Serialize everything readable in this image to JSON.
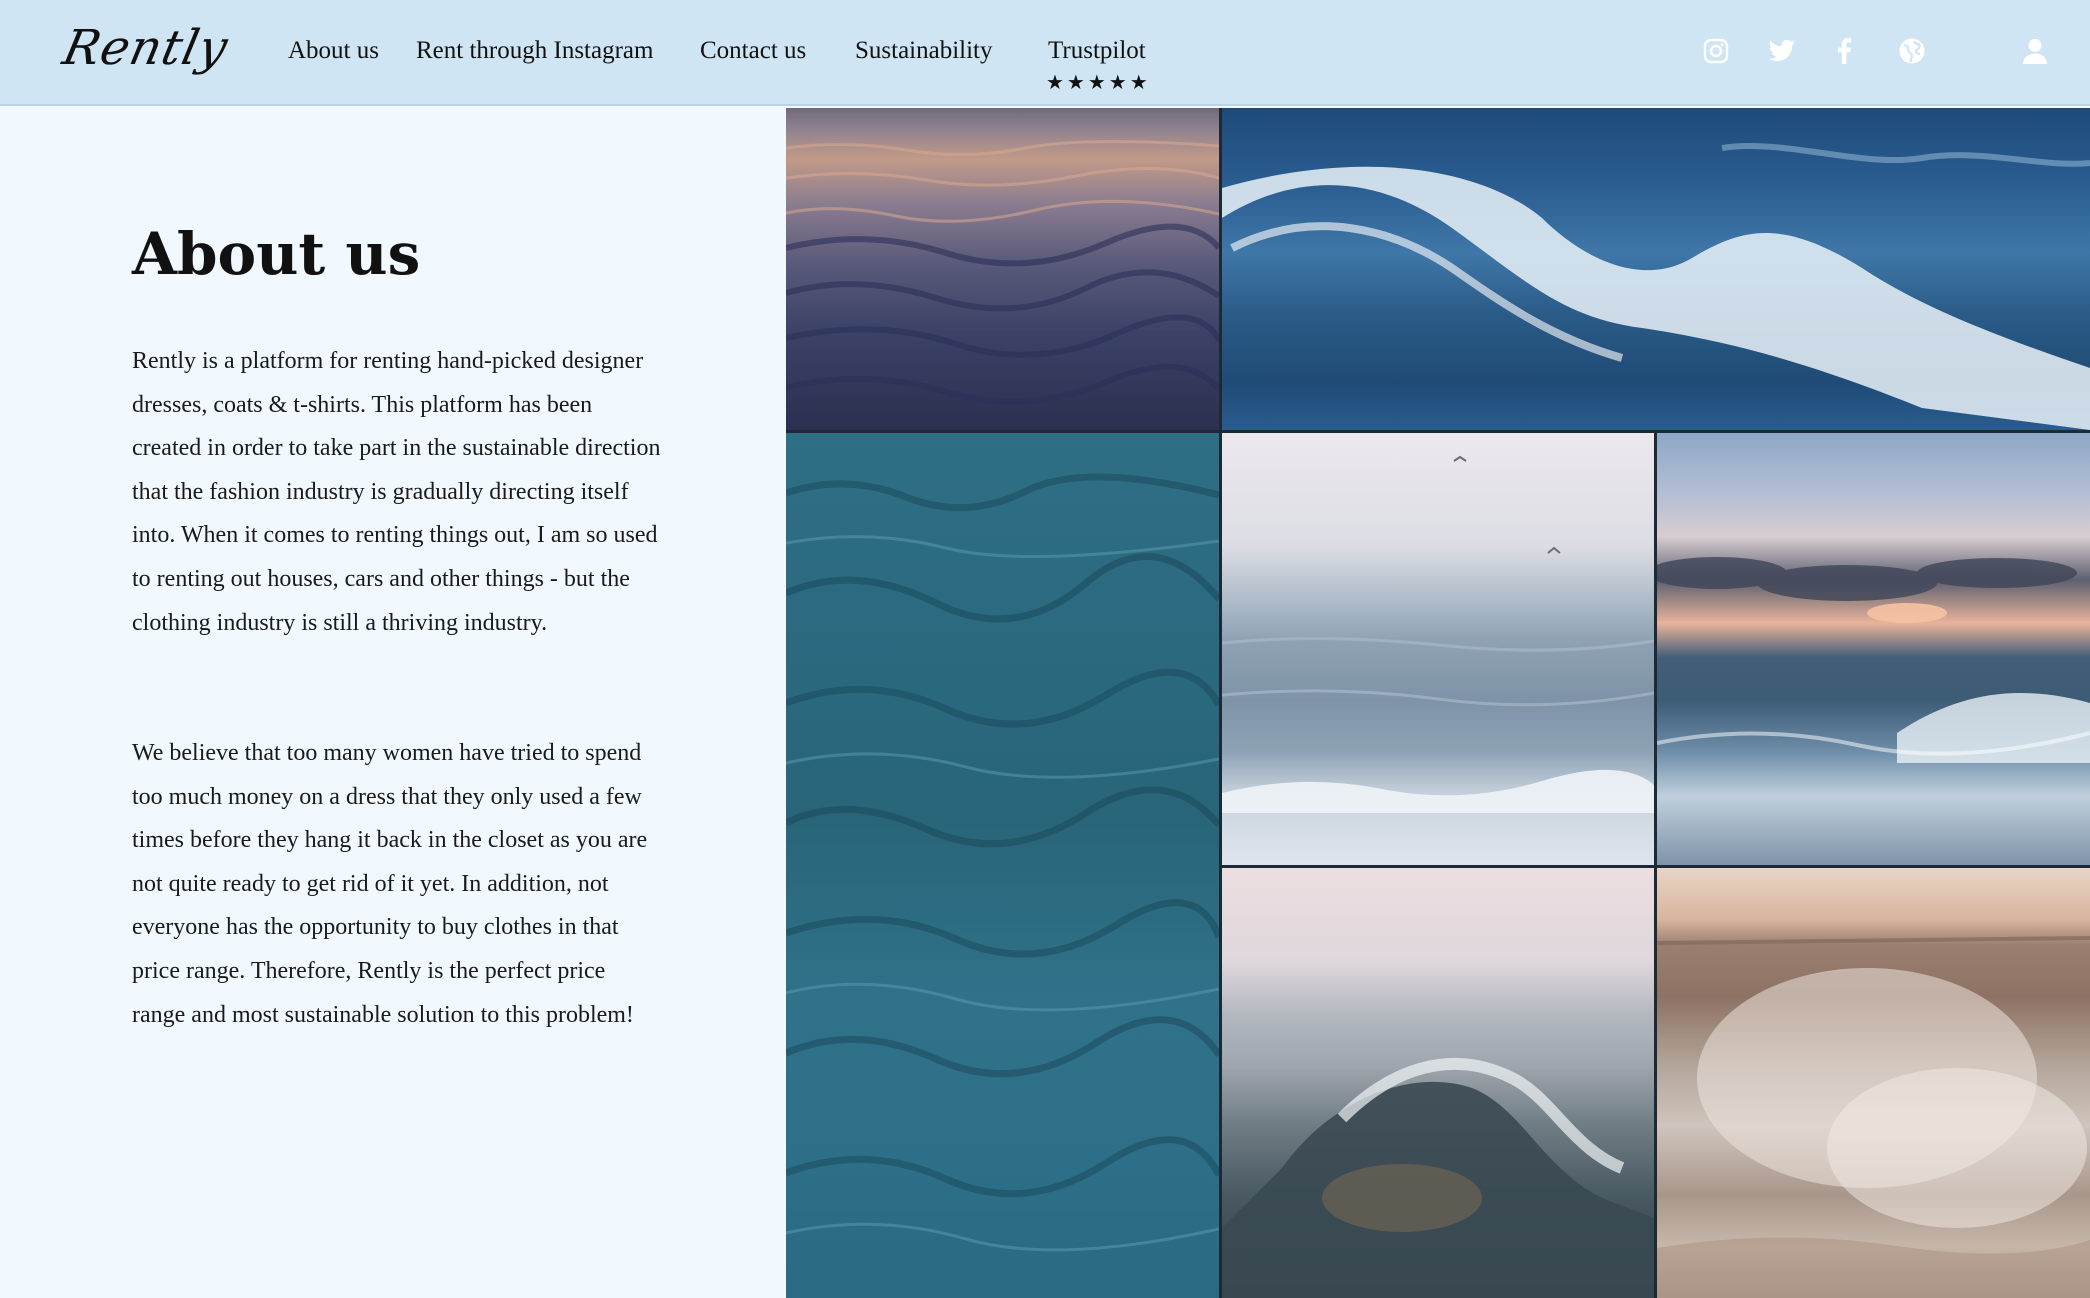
{
  "header": {
    "logo": "Rently",
    "nav": [
      {
        "label": "About us"
      },
      {
        "label": "Rent through Instagram"
      },
      {
        "label": "Contact us"
      },
      {
        "label": "Sustainability"
      },
      {
        "label": "Trustpilot"
      }
    ],
    "rating_stars": "★★★★★",
    "rating_value": 5,
    "social_icons": [
      "instagram-icon",
      "twitter-icon",
      "facebook-icon",
      "globe-icon"
    ],
    "account_icon": "user-icon"
  },
  "about": {
    "title": "About us",
    "paragraph_1": "Rently is a platform for renting hand-picked designer dresses, coats & t-shirts. This platform has been created in order to take part in the sustainable direction that the fashion industry is gradually directing itself into. When it comes to renting things out, I am so used to renting out houses, cars and other things - but the clothing industry is still a thriving industry.",
    "paragraph_2": "We believe that too many women have tried to spend too much money on a dress that they only used a few times before they hang it back in the closet as you are not quite ready to get rid of it yet. In addition, not everyone has the opportunity to buy clothes in that price range. Therefore, Rently is the perfect price range and most sustainable solution to this problem!"
  },
  "colors": {
    "header_bg": "#cfe5f4",
    "page_bg": "#f1f8fe",
    "text": "#111111",
    "header_icon": "#ffffff"
  }
}
